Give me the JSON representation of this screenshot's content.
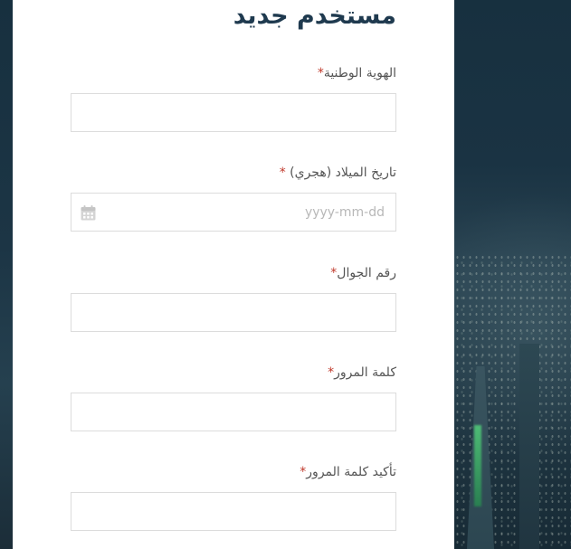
{
  "form": {
    "title": "مستخدم جديد",
    "required_mark": "*",
    "fields": [
      {
        "label": "الهوية الوطنية",
        "value": ""
      },
      {
        "label": "تاريخ الميلاد (هجري) ",
        "value": "",
        "placeholder": "yyyy-mm-dd",
        "icon": "calendar-icon"
      },
      {
        "label": "رقم الجوال",
        "value": ""
      },
      {
        "label": "كلمة المرور",
        "value": ""
      },
      {
        "label": "تأكيد كلمة المرور",
        "value": ""
      }
    ]
  },
  "colors": {
    "title": "#1f3a4f",
    "required": "#c0392b",
    "border": "#dcdcdc",
    "background": "#1b2f3c"
  }
}
